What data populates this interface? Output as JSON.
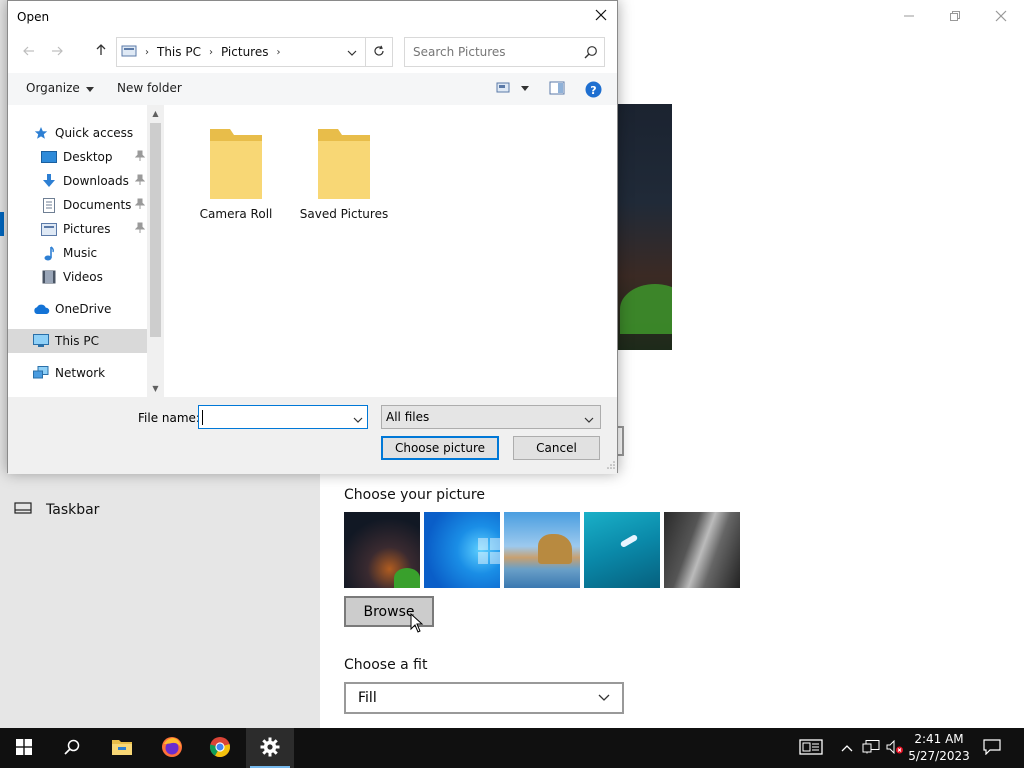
{
  "settings": {
    "nav_taskbar": "Taskbar",
    "choose_picture_label": "Choose your picture",
    "browse_label": "Browse",
    "choose_fit_label": "Choose a fit",
    "fit_value": "Fill",
    "thumbnails": [
      "thumbnail-night-sky-tent",
      "thumbnail-windows-blue",
      "thumbnail-beach-rocks",
      "thumbnail-underwater-swimmer",
      "thumbnail-rock-cliff"
    ]
  },
  "dialog": {
    "title": "Open",
    "breadcrumb": [
      "This PC",
      "Pictures"
    ],
    "search_placeholder": "Search Pictures",
    "toolbar": {
      "organize": "Organize",
      "new_folder": "New folder"
    },
    "nav_tree": {
      "quick_access": "Quick access",
      "desktop": "Desktop",
      "downloads": "Downloads",
      "documents": "Documents",
      "pictures": "Pictures",
      "music": "Music",
      "videos": "Videos",
      "onedrive": "OneDrive",
      "this_pc": "This PC",
      "network": "Network"
    },
    "folders": [
      "Camera Roll",
      "Saved Pictures"
    ],
    "file_name_label": "File name:",
    "file_name_value": "",
    "file_type": "All files",
    "choose_button": "Choose picture",
    "cancel_button": "Cancel"
  },
  "taskbar": {
    "time": "2:41 AM",
    "date": "5/27/2023"
  },
  "colors": {
    "accent": "#0078d7",
    "selected_nav": "#d9d9d9",
    "folder": "#f8d775"
  }
}
